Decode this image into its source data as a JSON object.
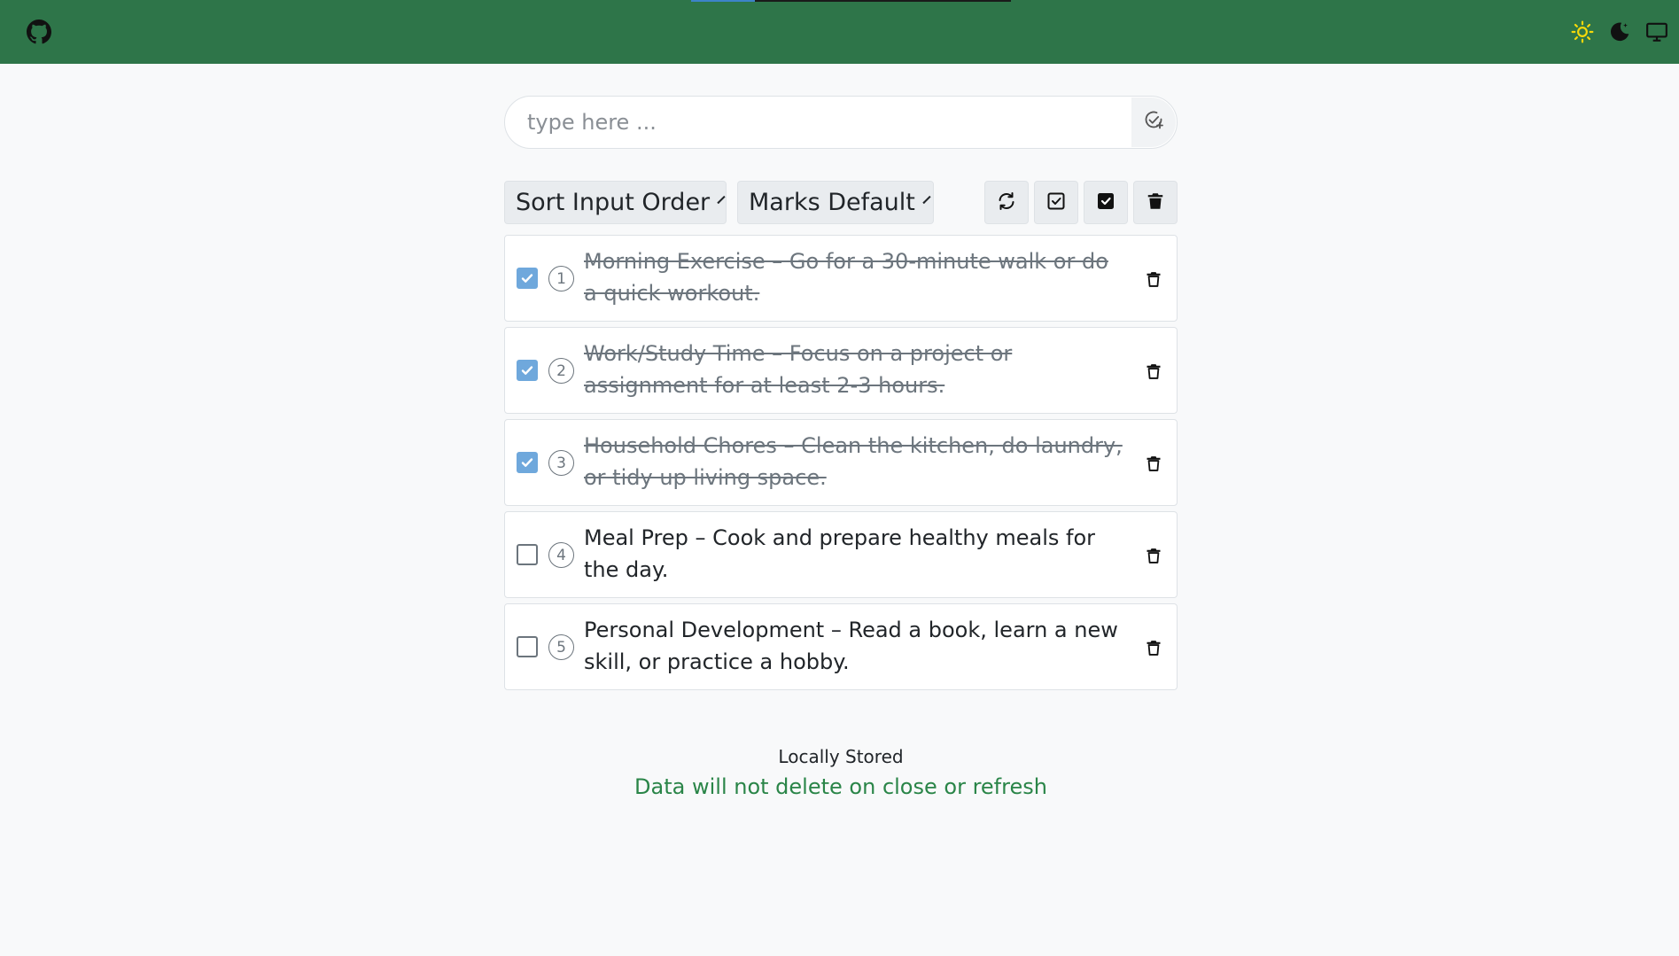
{
  "header": {
    "progress_fraction": 0.2,
    "github_icon": "github-icon",
    "theme_icons": [
      "sun-icon",
      "moon-icon",
      "monitor-icon"
    ],
    "bar_color": "#2e7549"
  },
  "add": {
    "placeholder": "type here ...",
    "button_icon": "check-add-icon"
  },
  "toolbar": {
    "sort_label": "Sort Input Order",
    "marks_label": "Marks Default",
    "buttons": [
      "refresh-icon",
      "check-square-icon",
      "check-square-filled-icon",
      "trash-filled-icon"
    ]
  },
  "todos": [
    {
      "num": "1",
      "text": "Morning Exercise – Go for a 30-minute walk or do a quick workout.",
      "done": true
    },
    {
      "num": "2",
      "text": "Work/Study Time – Focus on a project or assignment for at least 2-3 hours.",
      "done": true
    },
    {
      "num": "3",
      "text": "Household Chores – Clean the kitchen, do laundry, or tidy up living space.",
      "done": true
    },
    {
      "num": "4",
      "text": "Meal Prep – Cook and prepare healthy meals for the day.",
      "done": false
    },
    {
      "num": "5",
      "text": "Personal Development – Read a book, learn a new skill, or practice a hobby.",
      "done": false
    }
  ],
  "footer": {
    "title": "Locally Stored",
    "note": "Data will not delete on close or refresh"
  },
  "colors": {
    "accent_green": "#2a8548",
    "checkbox_blue": "#6fa8dc"
  }
}
